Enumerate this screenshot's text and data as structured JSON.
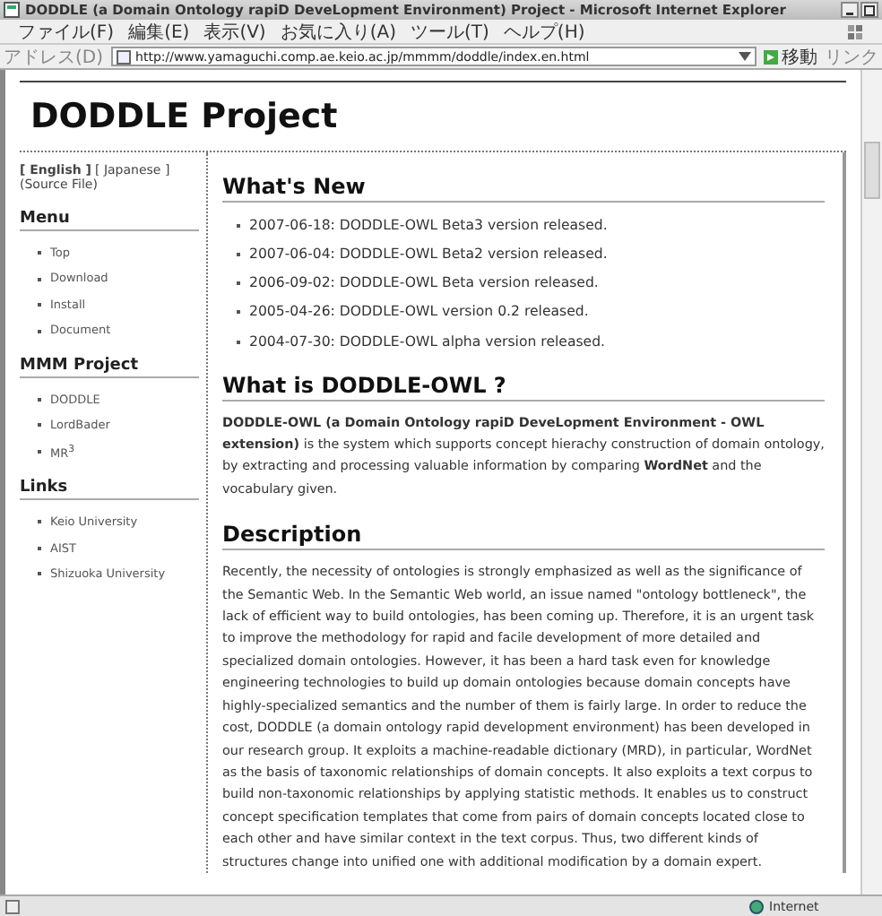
{
  "window": {
    "title": "DODDLE (a Domain Ontology rapiD DeveLopment Environment) Project - Microsoft Internet Explorer"
  },
  "menu_bar": [
    "ファイル(F)",
    "編集(E)",
    "表示(V)",
    "お気に入り(A)",
    "ツール(T)",
    "ヘルプ(H)"
  ],
  "address_bar": {
    "label": "アドレス(D)",
    "url": "http://www.yamaguchi.comp.ae.keio.ac.jp/mmmm/doddle/index.en.html",
    "go_button": "移動",
    "links": "リンク"
  },
  "page": {
    "title": "DODDLE Project",
    "language_links": [
      {
        "label": "[ English ]",
        "selected": true
      },
      {
        "label": "[ Japanese ]",
        "selected": false
      }
    ],
    "source_link": "(Source File)",
    "sidebar": [
      {
        "heading": "Menu",
        "items": [
          "Top",
          "Download",
          "Install",
          "Document"
        ]
      },
      {
        "heading": "MMM Project",
        "items": [
          "DODDLE",
          "LordBader",
          "MR$^{3}$"
        ]
      },
      {
        "heading": "Links",
        "items": [
          "Keio University",
          "AIST",
          "Shizuoka University"
        ]
      }
    ],
    "sections": [
      {
        "kind": "list",
        "heading": "What's New",
        "items": [
          "2007-06-18: DODDLE-OWL Beta3 version released.",
          "2007-06-04: DODDLE-OWL Beta2 version released.",
          "2006-09-02: DODDLE-OWL Beta version released.",
          "2005-04-26: DODDLE-OWL version 0.2 released.",
          "2004-07-30: DODDLE-OWL alpha version released."
        ]
      },
      {
        "kind": "text",
        "heading": "What is DODDLE-OWL ?",
        "text": "**DODDLE-OWL (a Domain Ontology rapiD DeveLopment Environment - OWL extension)** is the system which supports concept hierachy construction of domain ontology, by extracting and processing valuable information by comparing **WordNet** and the vocabulary given."
      },
      {
        "kind": "text",
        "heading": "Description",
        "text": "Recently, the necessity of ontologies is strongly emphasized as well as the significance of the Semantic Web. In the Semantic Web world, an issue named \"ontology bottleneck\", the lack of efficient way to build ontologies, has been coming up. Therefore, it is an urgent task to improve the methodology for rapid and facile development of more detailed and specialized domain ontologies. However, it has been a hard task even for knowledge engineering technologies to build up domain ontologies because domain concepts have highly-specialized semantics and the number of them is fairly large. In order to reduce the cost, DODDLE (a domain ontology rapid development environment) has been developed in our research group. It exploits a machine-readable dictionary (MRD), in particular, WordNet as the basis of taxonomic relationships of domain concepts. It also exploits a text corpus to build non-taxonomic relationships by applying statistic methods. It enables us to construct concept specification templates that come from pairs of domain concepts located close to each other and have similar context in the text corpus. Thus, two different kinds of structures change into unified one with additional modification by a domain expert."
      }
    ]
  },
  "status_bar": {
    "zone": "Internet"
  }
}
